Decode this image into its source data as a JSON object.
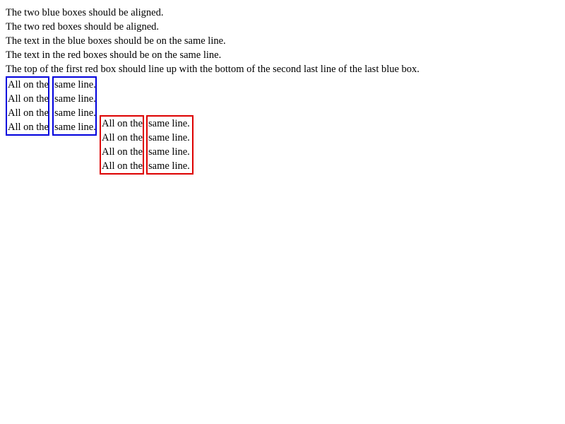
{
  "instructions": [
    "The two blue boxes should be aligned.",
    "The two red boxes should be aligned.",
    "The text in the blue boxes should be on the same line.",
    "The text in the red boxes should be on the same line.",
    "The top of the first red box should line up with the bottom of the second last line of the last blue box."
  ],
  "blue_boxes": {
    "color": "#0000dd",
    "first": [
      "All on the",
      "All on the",
      "All on the",
      "All on the"
    ],
    "second": [
      "same line.",
      "same line.",
      "same line.",
      "same line."
    ]
  },
  "red_boxes": {
    "color": "#dd0000",
    "first": [
      "All on the",
      "All on the",
      "All on the",
      "All on the"
    ],
    "second": [
      "same line.",
      "same line.",
      "same line.",
      "same line."
    ]
  }
}
